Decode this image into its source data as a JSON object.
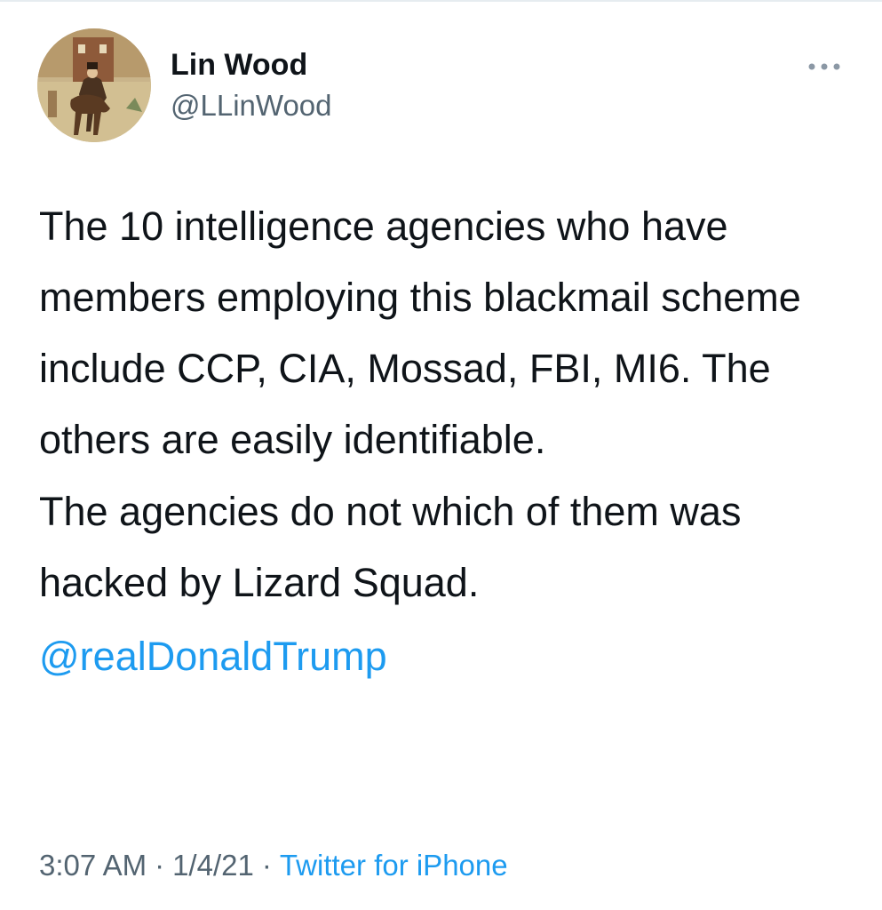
{
  "user": {
    "display_name": "Lin Wood",
    "handle": "@LLinWood",
    "avatar_icon": "avatar-painting-horse-rider"
  },
  "menu": {
    "more_icon": "more-horizontal-icon"
  },
  "tweet": {
    "paragraphs": [
      "The 10 intelligence agencies who have members employing this blackmail scheme include CCP, CIA, Mossad, FBI, MI6. The others are easily identifiable.",
      "The agencies do not which of them was hacked by Lizard Squad."
    ],
    "mention": "@realDonaldTrump"
  },
  "meta": {
    "time": "3:07 AM",
    "separator": "·",
    "date": "1/4/21",
    "source": "Twitter for iPhone"
  },
  "colors": {
    "text": "#0f1419",
    "secondary": "#536471",
    "link": "#1d9bf0"
  }
}
